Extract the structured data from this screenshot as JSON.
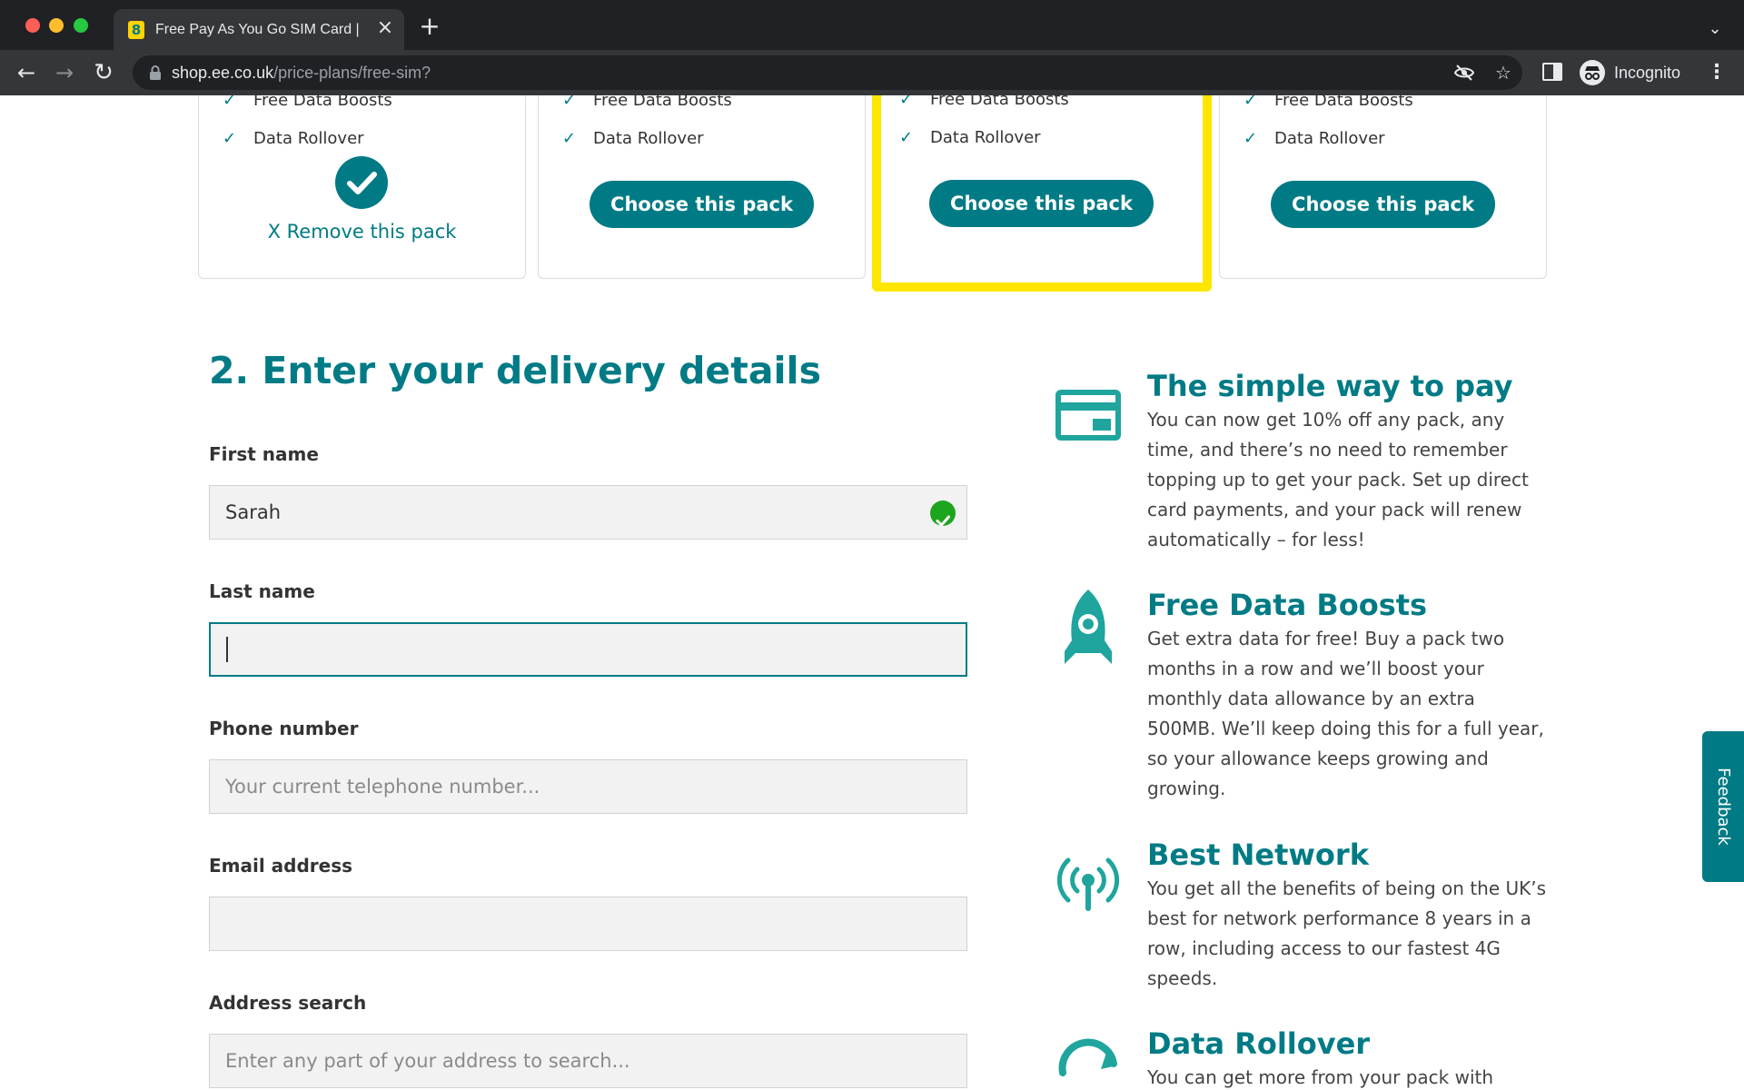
{
  "browser": {
    "tab_title": "Free Pay As You Go SIM Card | EE",
    "tab_favicon": "8",
    "url_host": "shop.ee.co.uk",
    "url_path": "/price-plans/free-sim?",
    "incognito_label": "Incognito"
  },
  "packs": [
    {
      "features": [
        "Free Data Boosts",
        "Data Rollover"
      ],
      "selected": true,
      "remove_label": "X Remove this pack"
    },
    {
      "features": [
        "Free Data Boosts",
        "Data Rollover"
      ],
      "selected": false,
      "button_label": "Choose this pack"
    },
    {
      "features": [
        "Free Data Boosts",
        "Data Rollover"
      ],
      "selected": false,
      "highlighted": true,
      "button_label": "Choose this pack"
    },
    {
      "features": [
        "Free Data Boosts",
        "Data Rollover"
      ],
      "selected": false,
      "button_label": "Choose this pack"
    }
  ],
  "delivery": {
    "title": "2. Enter your delivery details",
    "first_name_label": "First name",
    "first_name_value": "Sarah",
    "last_name_label": "Last name",
    "last_name_value": "",
    "phone_label": "Phone number",
    "phone_placeholder": "Your current telephone number...",
    "email_label": "Email address",
    "email_value": "",
    "address_label": "Address search",
    "address_placeholder": "Enter any part of your address to search..."
  },
  "benefits": [
    {
      "icon": "card-icon",
      "title": "The simple way to pay",
      "text": "You can now get 10% off any pack, any time, and there’s no need to remember topping up to get your pack. Set up direct card payments, and your pack will renew automatically – for less!"
    },
    {
      "icon": "rocket-icon",
      "title": "Free Data Boosts",
      "text": "Get extra data for free! Buy a pack two months in a row and we’ll boost your monthly data allowance by an extra 500MB. We’ll keep doing this for a full year, so your allowance keeps growing and growing."
    },
    {
      "icon": "antenna-icon",
      "title": "Best Network",
      "text": "You get all the benefits of being on the UK’s best for network performance 8 years in a row, including access to our fastest 4G speeds."
    },
    {
      "icon": "rollover-icon",
      "title": "Data Rollover",
      "text": "You can get more from your pack with"
    }
  ],
  "feedback_label": "Feedback",
  "colors": {
    "brand": "#007b85",
    "highlight": "#ffe600",
    "valid": "#1ea51e"
  }
}
